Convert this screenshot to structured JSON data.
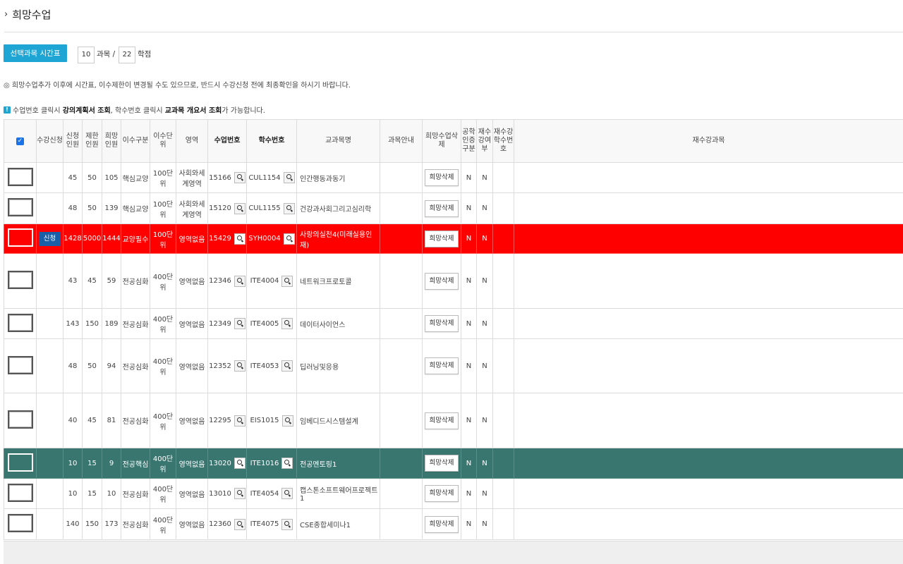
{
  "page": {
    "title": "희망수업"
  },
  "toolbar": {
    "timetable_button": "선택과목 시간표보기",
    "course_count": "10",
    "course_label": "과목 /",
    "credit_count": "22",
    "credit_label": "학점"
  },
  "notices": {
    "line1": "◎ 희망수업추가 이후에 시간표, 이수제한이 변경될 수도 있으므로, 반드시 수강신청 전에 최종확인을 하시기 바랍니다.",
    "line2_a": "수업번호 클릭시 ",
    "line2_b": "강의계획서 조회",
    "line2_c": ", 학수번호 클릭시 ",
    "line2_d": "교과목 개요서 조회",
    "line2_e": "가 가능합니다."
  },
  "table": {
    "headers": {
      "check": "✓",
      "apply": "수강신청",
      "applied": "신청인원",
      "limit": "제한인원",
      "wish": "희망인원",
      "type": "이수구분",
      "unit": "이수단위",
      "area": "영역",
      "class_no": "수업번호",
      "course_no": "학수번호",
      "name": "교과목명",
      "guide": "과목안내",
      "wish_del": "희망수업삭제",
      "eng": "공학인증구분",
      "retake": "재수강여부",
      "retake_no": "재수강학수번호",
      "retake_course": "재수강과목"
    },
    "delete_label": "희망삭제",
    "apply_label": "신청",
    "rows": [
      {
        "applied": "45",
        "limit": "50",
        "wish": "105",
        "type": "핵심교양",
        "unit": "100단위",
        "area": "사회와세계영역",
        "class_no": "15166",
        "course_no": "CUL1154",
        "name": "인간행동과동기",
        "eng": "N",
        "retake": "N",
        "apply": ""
      },
      {
        "applied": "48",
        "limit": "50",
        "wish": "139",
        "type": "핵심교양",
        "unit": "100단위",
        "area": "사회와세계영역",
        "class_no": "15120",
        "course_no": "CUL1155",
        "name": "건강과사회그리고심리학",
        "eng": "N",
        "retake": "N",
        "apply": ""
      },
      {
        "applied": "1428",
        "limit": "5000",
        "wish": "1444",
        "type": "교양필수",
        "unit": "100단위",
        "area": "영역없음",
        "class_no": "15429",
        "course_no": "SYH0004",
        "name": "사랑의실천4(미래실용인재)",
        "eng": "N",
        "retake": "N",
        "apply": "신청"
      },
      {
        "applied": "43",
        "limit": "45",
        "wish": "59",
        "type": "전공심화",
        "unit": "400단위",
        "area": "영역없음",
        "class_no": "12346",
        "course_no": "ITE4004",
        "name": "네트워크프로토콜",
        "eng": "N",
        "retake": "N",
        "apply": ""
      },
      {
        "applied": "143",
        "limit": "150",
        "wish": "189",
        "type": "전공심화",
        "unit": "400단위",
        "area": "영역없음",
        "class_no": "12349",
        "course_no": "ITE4005",
        "name": "데이터사이언스",
        "eng": "N",
        "retake": "N",
        "apply": ""
      },
      {
        "applied": "48",
        "limit": "50",
        "wish": "94",
        "type": "전공심화",
        "unit": "400단위",
        "area": "영역없음",
        "class_no": "12352",
        "course_no": "ITE4053",
        "name": "딥러닝및응용",
        "eng": "N",
        "retake": "N",
        "apply": ""
      },
      {
        "applied": "40",
        "limit": "45",
        "wish": "81",
        "type": "전공심화",
        "unit": "400단위",
        "area": "영역없음",
        "class_no": "12295",
        "course_no": "EIS1015",
        "name": "임베디드시스템설계",
        "eng": "N",
        "retake": "N",
        "apply": ""
      },
      {
        "applied": "10",
        "limit": "15",
        "wish": "9",
        "type": "전공핵심",
        "unit": "400단위",
        "area": "영역없음",
        "class_no": "13020",
        "course_no": "ITE1016",
        "name": "전공멘토링1",
        "eng": "N",
        "retake": "N",
        "apply": ""
      },
      {
        "applied": "10",
        "limit": "15",
        "wish": "10",
        "type": "전공심화",
        "unit": "400단위",
        "area": "영역없음",
        "class_no": "13010",
        "course_no": "ITE4054",
        "name": "캡스톤소프트웨어프로젝트1",
        "eng": "N",
        "retake": "N",
        "apply": ""
      },
      {
        "applied": "140",
        "limit": "150",
        "wish": "173",
        "type": "전공심화",
        "unit": "400단위",
        "area": "영역없음",
        "class_no": "12360",
        "course_no": "ITE4075",
        "name": "CSE종합세미나1",
        "eng": "N",
        "retake": "N",
        "apply": ""
      }
    ]
  },
  "colors": {
    "accent": "#1ea5d3",
    "highlight_red": "#ff0000",
    "highlight_green": "#3a7670",
    "apply_blue": "#1b5ea8"
  }
}
